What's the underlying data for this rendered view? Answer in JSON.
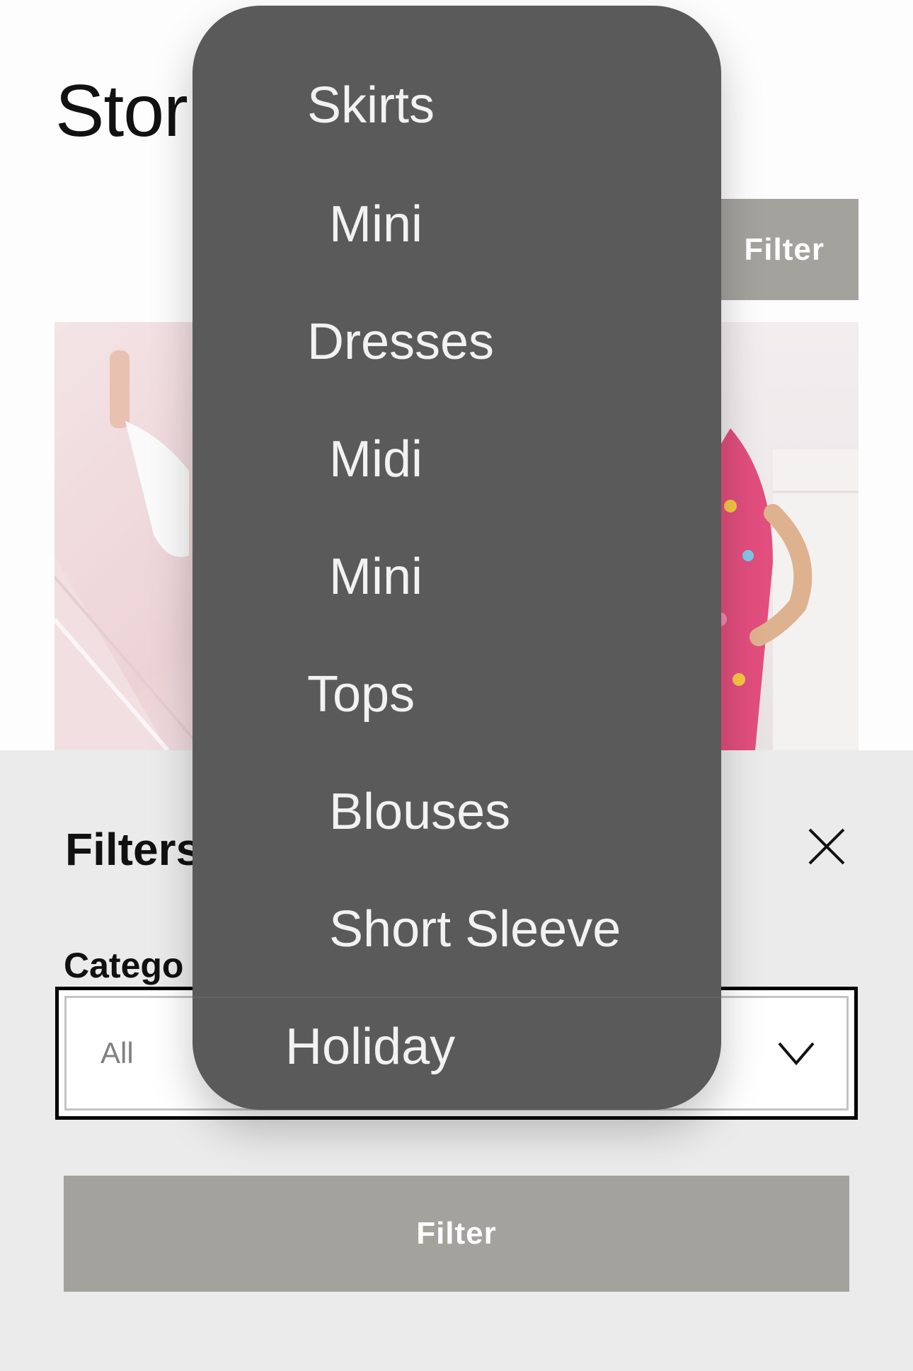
{
  "header": {
    "title": "Stor",
    "filter_button_label": "Filter"
  },
  "product_images": [
    {
      "name": "product-left"
    },
    {
      "name": "product-right"
    }
  ],
  "filters": {
    "title": "Filters",
    "category_label": "Catego",
    "category_value": "All",
    "filter_button_label": "Filter"
  },
  "dropdown": {
    "items": [
      {
        "label": "Skirts",
        "level": 1
      },
      {
        "label": "Mini",
        "level": 2
      },
      {
        "label": "Dresses",
        "level": 1
      },
      {
        "label": "Midi",
        "level": 2
      },
      {
        "label": "Mini",
        "level": 2
      },
      {
        "label": "Tops",
        "level": 1
      },
      {
        "label": "Blouses",
        "level": 2
      },
      {
        "label": "Short Sleeve",
        "level": 2
      },
      {
        "label": "Holiday",
        "level": 0
      }
    ]
  },
  "icons": {
    "close": "close-icon",
    "chevron": "chevron-down-icon"
  },
  "colors": {
    "button_bg": "#a3a29d",
    "dropdown_bg": "#5a5a5a",
    "sheet_bg": "#ebebeb"
  }
}
